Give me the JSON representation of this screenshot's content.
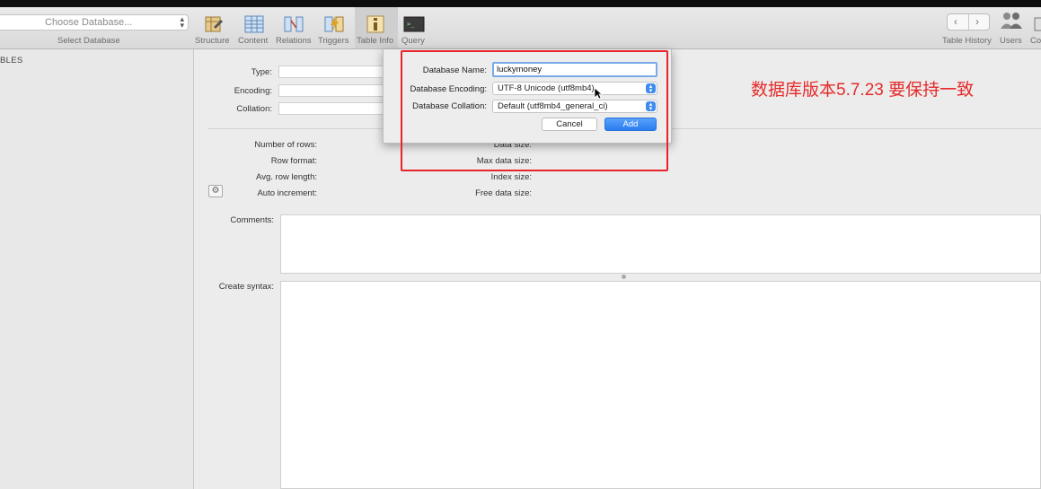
{
  "toolbar": {
    "database_select_placeholder": "Choose Database...",
    "database_select_label": "Select Database",
    "tabs": [
      {
        "label": "Structure",
        "icon": "structure-icon"
      },
      {
        "label": "Content",
        "icon": "content-icon"
      },
      {
        "label": "Relations",
        "icon": "relations-icon"
      },
      {
        "label": "Triggers",
        "icon": "triggers-icon"
      },
      {
        "label": "Table Info",
        "icon": "table-info-icon"
      },
      {
        "label": "Query",
        "icon": "query-icon"
      }
    ],
    "active_tab": "Table Info",
    "right": {
      "history_label": "Table History",
      "users_label": "Users",
      "console_label": "Co"
    }
  },
  "sidebar": {
    "header": "BLES"
  },
  "table_info": {
    "type_label": "Type:",
    "encoding_label": "Encoding:",
    "collation_label": "Collation:",
    "number_of_rows_label": "Number of rows:",
    "row_format_label": "Row format:",
    "avg_row_length_label": "Avg. row length:",
    "auto_increment_label": "Auto increment:",
    "data_size_label": "Data size:",
    "max_data_size_label": "Max data size:",
    "index_size_label": "Index size:",
    "free_data_size_label": "Free data size:",
    "comments_label": "Comments:",
    "create_syntax_label": "Create syntax:"
  },
  "dialog": {
    "name_label": "Database Name:",
    "name_value": "luckymoney",
    "encoding_label": "Database Encoding:",
    "encoding_value": "UTF-8 Unicode (utf8mb4)",
    "collation_label": "Database Collation:",
    "collation_value": "Default (utf8mb4_general_ci)",
    "cancel_label": "Cancel",
    "add_label": "Add"
  },
  "annotation": {
    "text": "数据库版本5.7.23   要保持一致",
    "color": "#e52a2a"
  },
  "colors": {
    "accent": "#2a7cf0",
    "highlight_border": "#e8242b"
  }
}
